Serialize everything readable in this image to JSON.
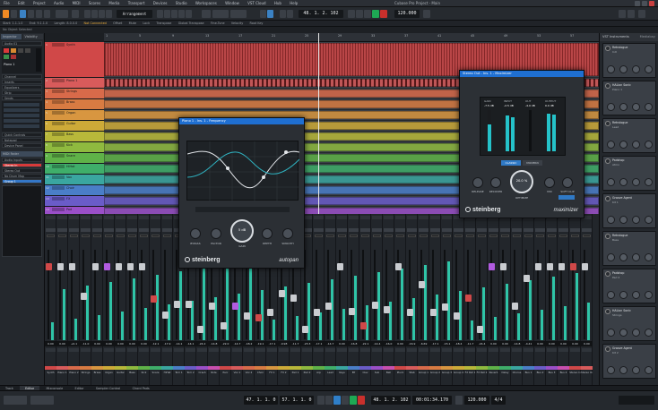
{
  "menubar": {
    "items": [
      "File",
      "Edit",
      "Project",
      "Audio",
      "MIDI",
      "Scores",
      "Media",
      "Transport",
      "Devices",
      "Studio",
      "Workspaces",
      "Window",
      "VST Cloud",
      "Hub",
      "Help"
    ],
    "title": "Cubase Pro Project - Main"
  },
  "toolbar": {
    "workspace": "Arrangement",
    "position": "48. 1. 2. 102",
    "tempo": "120.000"
  },
  "infoline": {
    "items": [
      "Start: 1.1.1.0",
      "End: 9.1.1.0",
      "Length: 8.0.0.0",
      "Offset",
      "Mute",
      "Lock",
      "Transpose",
      "Global Transpose",
      "Fine-Tune",
      "Velocity",
      "Root Key"
    ],
    "highlight": "Not Connected"
  },
  "statusline": {
    "text": "No Object Selected"
  },
  "inspector": {
    "tabs": [
      "Inspector",
      "Visibility"
    ],
    "sections": [
      "Audio 01",
      "Channel",
      "Inserts",
      "Equalizers",
      "Strip",
      "Sends",
      "Quick Controls",
      "Notepad",
      "Device Panel"
    ],
    "track_name": "Piano 1",
    "buttons": [
      "Read",
      "Write",
      "e",
      "Mute",
      "Solo",
      "Monitor"
    ],
    "lower": [
      "MIDI Fader",
      "Audio Inputs",
      "Stereo In",
      "Stereo Out",
      "No Drum Map",
      "Group 1"
    ]
  },
  "tracks": [
    {
      "num": "1",
      "name": "Synth",
      "color": "#d04848"
    },
    {
      "num": "2",
      "name": "Piano 1",
      "color": "#d85b5b"
    },
    {
      "num": "3",
      "name": "Strings",
      "color": "#d86a4a"
    },
    {
      "num": "4",
      "name": "Brass",
      "color": "#d87b42"
    },
    {
      "num": "5",
      "name": "Organ",
      "color": "#d89640"
    },
    {
      "num": "6",
      "name": "Guitar",
      "color": "#cdaa38"
    },
    {
      "num": "7",
      "name": "Bass",
      "color": "#b8b83a"
    },
    {
      "num": "8",
      "name": "Kick",
      "color": "#8fba3f"
    },
    {
      "num": "9",
      "name": "Snare",
      "color": "#5fb248"
    },
    {
      "num": "10",
      "name": "HiHat",
      "color": "#3fae6a"
    },
    {
      "num": "11",
      "name": "Vox",
      "color": "#3aa6a0"
    },
    {
      "num": "12",
      "name": "Choir",
      "color": "#4a7ec8"
    },
    {
      "num": "13",
      "name": "FX",
      "color": "#6a5cc8"
    },
    {
      "num": "14",
      "name": "Pad",
      "color": "#9a4fc8"
    },
    {
      "num": "15",
      "name": "Master",
      "color": "#c84fae"
    }
  ],
  "ruler": {
    "marks": [
      "1",
      "5",
      "9",
      "13",
      "17",
      "21",
      "25",
      "29",
      "33",
      "37",
      "41",
      "45",
      "49",
      "53",
      "57"
    ]
  },
  "right_zone": {
    "tabs": [
      "VST Instruments",
      "Mediabay"
    ],
    "instruments": [
      {
        "name": "Retrologue",
        "preset": "Init"
      },
      {
        "name": "HALion Sonic",
        "preset": "Piano 1"
      },
      {
        "name": "Retrologue",
        "preset": "Lead"
      },
      {
        "name": "Padshop",
        "preset": "Atmo"
      },
      {
        "name": "Groove Agent",
        "preset": "Kit 1"
      },
      {
        "name": "Retrologue",
        "preset": "Bass"
      },
      {
        "name": "Padshop",
        "preset": "Pad 2"
      },
      {
        "name": "HALion Sonic",
        "preset": "Strings"
      },
      {
        "name": "Groove Agent",
        "preset": "Kit 2"
      }
    ]
  },
  "plugin_eq": {
    "title": "Piano 1 - Ins. 1 - Frequency",
    "knobs": [
      "BYPASS",
      "FACTOR",
      "GAIN",
      "DEPTH",
      "SMOOTH"
    ],
    "center": "5 dB",
    "brand": "steinberg",
    "name": "autopan"
  },
  "plugin_comp": {
    "title": "Stereo Out - Ins. 1 - Maximizer",
    "labels": [
      "GAIN",
      "INPUT",
      "OUT",
      "OUTPUT"
    ],
    "values": [
      "-7.5 dB",
      "-2.5 dB",
      "-4.0 dB",
      "0.0 dB"
    ],
    "modes": [
      "CLASSIC",
      "MODERN"
    ],
    "knobs": [
      "RELEASE",
      "RECOVER",
      "OPTIMIZE",
      "MIX",
      "SOFT CLIP"
    ],
    "center": "20.0 %",
    "brand": "steinberg",
    "name": "maximizer"
  },
  "mixer": {
    "db_values": [
      "0.00",
      "0.00",
      "+0.1",
      "-11.0",
      "0.00",
      "0.00",
      "0.00",
      "0.00",
      "0.00",
      "-12.1",
      "-17.9",
      "-14.1",
      "-14.1",
      "-24.2",
      "-14.8",
      "-22.0",
      "-14.7",
      "-18.2",
      "-19.1",
      "-17.1",
      "-9.98",
      "-11.7",
      "-23.3",
      "-17.1",
      "-14.7",
      "0.00",
      "-16.8",
      "-22.1",
      "-14.4",
      "-16.0",
      "0.00",
      "-16.9",
      "-6.69",
      "-17.1",
      "-15.1",
      "-18.4",
      "-11.7",
      "-24.4",
      "0.00",
      "0.00",
      "-14.8",
      "-4.41",
      "0.00",
      "0.00",
      "0.00",
      "0.00",
      "0.00"
    ],
    "channel_names": [
      "Synth",
      "Piano 1",
      "Piano 2",
      "Strings",
      "Brass",
      "Organ",
      "Guitar",
      "Bass",
      "Kick",
      "Snare",
      "HiHat",
      "Tom 1",
      "Tom 2",
      "Crash",
      "Ride",
      "Perc",
      "Vox 1",
      "Vox 2",
      "Choir",
      "FX 1",
      "FX 2",
      "Pad 1",
      "Pad 2",
      "Arp",
      "Lead",
      "Keys",
      "EP",
      "Clav",
      "Sub",
      "Bell",
      "Pluck",
      "Stab",
      "Group 1",
      "Group 2",
      "Group 3",
      "Group 4",
      "FX Ret 1",
      "FX Ret 2",
      "Reverb",
      "Delay",
      "Chorus",
      "Bus 1",
      "Bus 2",
      "Bus 3",
      "Bus 4",
      "Stereo In",
      "Stereo Out"
    ]
  },
  "bottom_tabs": [
    "Track",
    "Editor",
    "Mixconsole",
    "Editor",
    "Sampler Control",
    "Chord Pads"
  ],
  "transport": {
    "left_locator": "47. 1. 1. 0",
    "right_locator": "57. 1. 1. 0",
    "position": "48. 1. 2. 102",
    "time": "00:01:34.170",
    "tempo": "120.000",
    "signature": "4/4"
  },
  "colors": {
    "accent": "#f08a24",
    "play": "#1ea854",
    "record": "#c9302c",
    "cycle": "#2f7fc9",
    "meter": "#2fc4a7"
  }
}
